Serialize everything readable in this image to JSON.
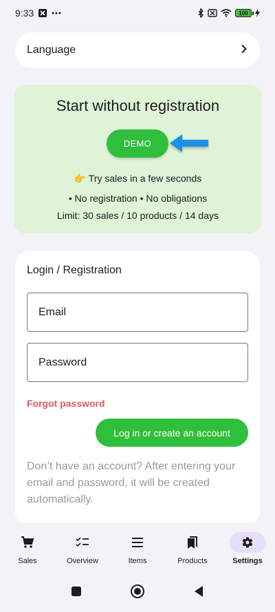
{
  "status_bar": {
    "time": "9:33",
    "battery": "100",
    "icons": [
      "app-notification-icon",
      "more-dots-icon",
      "bluetooth-icon",
      "sim-off-icon",
      "wifi-icon",
      "battery-icon",
      "charging-icon"
    ]
  },
  "language": {
    "label": "Language",
    "icon": "chevron-right-icon"
  },
  "demo": {
    "title": "Start without registration",
    "button_label": "DEMO",
    "try_text": "👉 Try sales in a few seconds",
    "features_text": "• No registration • No obligations",
    "limit_text": "Limit: 30 sales / 10 products / 14 days"
  },
  "login": {
    "title": "Login / Registration",
    "email_label": "Email",
    "password_label": "Password",
    "forgot_label": "Forgot password",
    "submit_label": "Log in or create an account",
    "hint": "Don’t have an account? After entering your email and password, it will be created automatically."
  },
  "nav": {
    "items": [
      {
        "label": "Sales",
        "icon": "cart-icon"
      },
      {
        "label": "Overview",
        "icon": "checklist-icon"
      },
      {
        "label": "Items",
        "icon": "list-icon"
      },
      {
        "label": "Products",
        "icon": "bookmarks-icon"
      },
      {
        "label": "Settings",
        "icon": "gear-icon"
      }
    ],
    "active": "Settings"
  },
  "colors": {
    "accent_green": "#2fbf3c",
    "demo_bg": "#dff3d7",
    "danger": "#e35a5a",
    "active_nav": "#e6defa",
    "arrow_blue": "#1e90e6"
  }
}
